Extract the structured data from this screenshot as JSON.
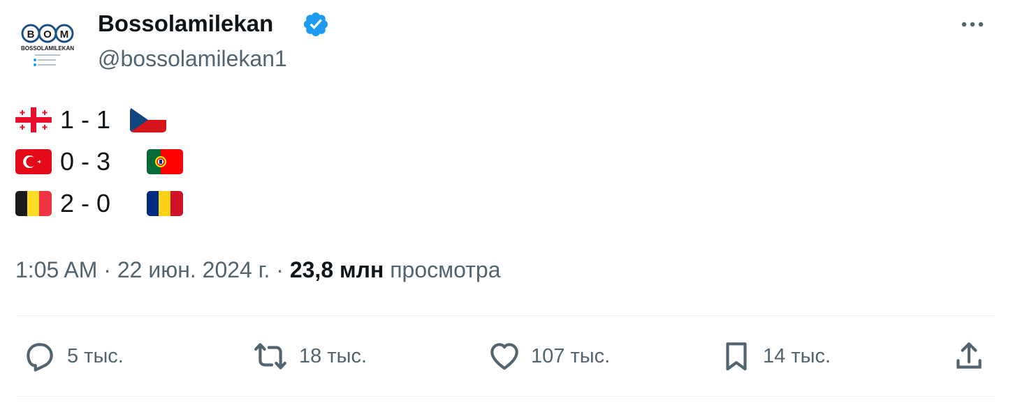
{
  "author": {
    "display_name": "Bossolamilekan",
    "handle": "@bossolamilekan1",
    "avatar": {
      "logo_text": "BOM",
      "subtitle_text": "BOSSOLAMILEKAN"
    },
    "verified": true
  },
  "scores": [
    {
      "home_flag": "georgia-flag-icon",
      "score": "1 - 1",
      "away_flag": "czechia-flag-icon"
    },
    {
      "home_flag": "turkey-flag-icon",
      "score": "0 - 3",
      "away_flag": "portugal-flag-icon"
    },
    {
      "home_flag": "belgium-flag-icon",
      "score": "2 - 0",
      "away_flag": "romania-flag-icon"
    }
  ],
  "meta": {
    "time": "1:05 AM",
    "separator": "·",
    "date": "22 июн. 2024 г.",
    "views_count": "23,8 млн",
    "views_label": "просмотра"
  },
  "actions": {
    "replies": {
      "icon": "reply-icon",
      "count": "5 тыс."
    },
    "reposts": {
      "icon": "repost-icon",
      "count": "18 тыс."
    },
    "likes": {
      "icon": "heart-icon",
      "count": "107 тыс."
    },
    "bookmarks": {
      "icon": "bookmark-icon",
      "count": "14 тыс."
    },
    "share": {
      "icon": "share-icon"
    }
  },
  "colors": {
    "text_primary": "#0f1419",
    "text_secondary": "#536471",
    "verified_blue": "#1d9bf0",
    "divider": "#eff3f4"
  }
}
